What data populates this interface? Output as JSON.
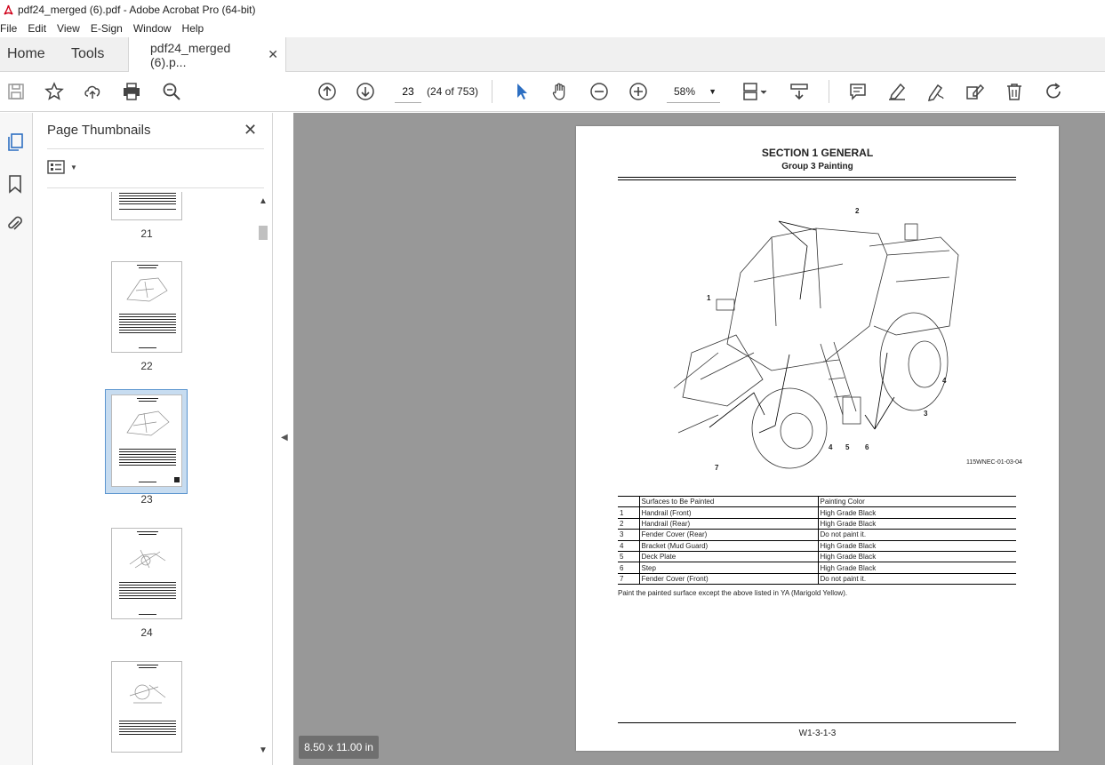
{
  "window": {
    "title": "pdf24_merged (6).pdf - Adobe Acrobat Pro (64-bit)"
  },
  "menu": {
    "items": [
      "File",
      "Edit",
      "View",
      "E-Sign",
      "Window",
      "Help"
    ]
  },
  "tabs": {
    "home": "Home",
    "tools": "Tools",
    "document": "pdf24_merged (6).p..."
  },
  "toolbar": {
    "page_number": "23",
    "page_count": "(24 of 753)",
    "zoom": "58%"
  },
  "panel": {
    "title": "Page Thumbnails",
    "thumbnails": [
      {
        "label": "21"
      },
      {
        "label": "22"
      },
      {
        "label": "23",
        "selected": true
      },
      {
        "label": "24"
      },
      {
        "label": "25"
      }
    ]
  },
  "document": {
    "section_title": "SECTION 1 GENERAL",
    "group_title": "Group 3 Painting",
    "figure_code": "115WNEC-01-03-04",
    "callouts": [
      "1",
      "2",
      "3",
      "4",
      "5",
      "6",
      "7"
    ],
    "table": {
      "headers": [
        "",
        "Surfaces to Be Painted",
        "Painting Color"
      ],
      "rows": [
        [
          "1",
          "Handrail (Front)",
          "High Grade Black"
        ],
        [
          "2",
          "Handrail (Rear)",
          "High Grade Black"
        ],
        [
          "3",
          "Fender Cover (Rear)",
          "Do not paint it."
        ],
        [
          "4",
          "Bracket (Mud Guard)",
          "High Grade Black"
        ],
        [
          "5",
          "Deck Plate",
          "High Grade Black"
        ],
        [
          "6",
          "Step",
          "High Grade Black"
        ],
        [
          "7",
          "Fender Cover (Front)",
          "Do not paint it."
        ]
      ]
    },
    "note": "Paint the painted surface except the above listed in YA (Marigold Yellow).",
    "footer": "W1-3-1-3"
  },
  "status": {
    "page_size": "8.50 x 11.00 in"
  }
}
